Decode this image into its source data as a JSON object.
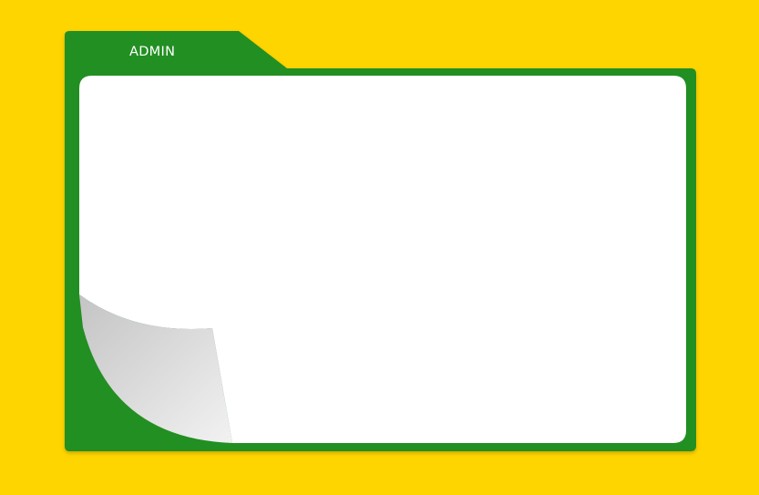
{
  "folder": {
    "tab_label": "ADMIN",
    "icon": "folder-icon"
  },
  "colors": {
    "background": "#FFD500",
    "folder": "#228F22",
    "sheet": "#FFFFFF",
    "curl": "#D9D9D9"
  }
}
